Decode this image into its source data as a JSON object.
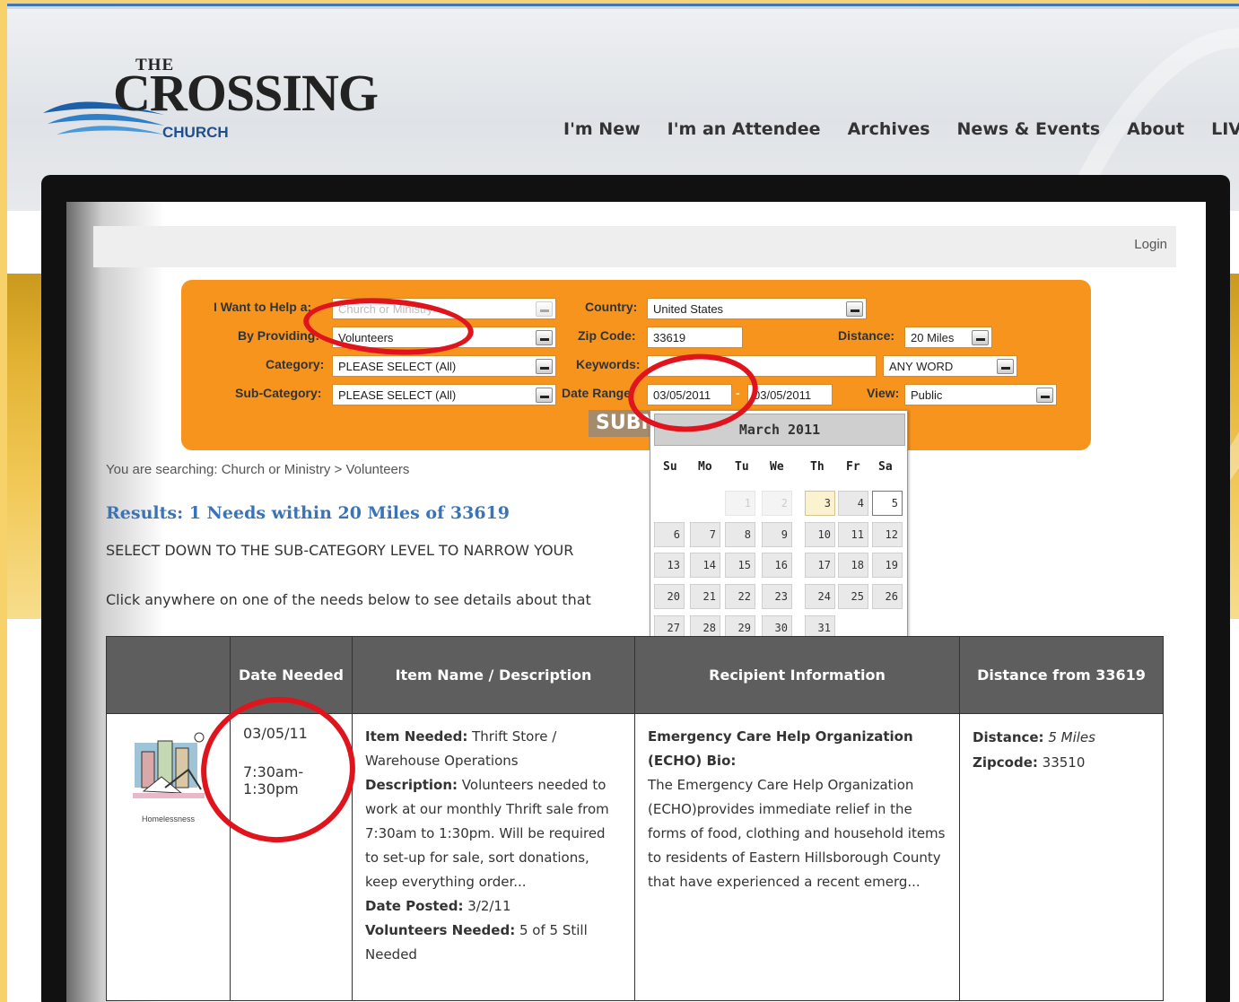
{
  "nav": [
    "I'm New",
    "I'm an Attendee",
    "Archives",
    "News & Events",
    "About",
    "LIVE"
  ],
  "logo": {
    "the": "THE",
    "crossing": "CROSSING",
    "church": "CHURCH"
  },
  "login": "Login",
  "search": {
    "help_label": "I Want to Help a:",
    "help_value": "Church or Ministry",
    "providing_label": "By Providing:",
    "providing_value": "Volunteers",
    "category_label": "Category:",
    "category_value": "PLEASE SELECT (All)",
    "subcategory_label": "Sub-Category:",
    "subcategory_value": "PLEASE SELECT (All)",
    "country_label": "Country:",
    "country_value": "United States",
    "zip_label": "Zip Code:",
    "zip_value": "33619",
    "distance_label": "Distance:",
    "distance_value": "20 Miles",
    "keywords_label": "Keywords:",
    "keywords_value": "",
    "keyword_mode": "ANY WORD",
    "daterange_label": "Date Range:",
    "date_from": "03/05/2011",
    "date_sep": "-",
    "date_to": "03/05/2011",
    "view_label": "View:",
    "view_value": "Public",
    "submit": "SUBMIT"
  },
  "calendar": {
    "title": "March 2011",
    "dow": [
      "Su",
      "Mo",
      "Tu",
      "We",
      "Th",
      "Fr",
      "Sa"
    ],
    "weeks": [
      [
        "",
        "",
        "1",
        "2",
        "3",
        "4",
        "5"
      ],
      [
        "6",
        "7",
        "8",
        "9",
        "10",
        "11",
        "12"
      ],
      [
        "13",
        "14",
        "15",
        "16",
        "17",
        "18",
        "19"
      ],
      [
        "20",
        "21",
        "22",
        "23",
        "24",
        "25",
        "26"
      ],
      [
        "27",
        "28",
        "29",
        "30",
        "31",
        "",
        ""
      ]
    ]
  },
  "breadcrumb": "You are searching: Church or Ministry > Volunteers",
  "results_title": "Results: 1 Needs within 20 Miles of 33619",
  "narrow_text": "SELECT DOWN TO THE SUB-CATEGORY LEVEL TO NARROW YOUR",
  "click_text": "Click anywhere on one of the needs below to see details about that",
  "table": {
    "headers": [
      "",
      "Date Needed",
      "Item Name / Description",
      "Recipient Information",
      "Distance from 33619"
    ],
    "row": {
      "category": "Homelessness",
      "date": "03/05/11",
      "time": "7:30am-1:30pm",
      "item_label": "Item Needed:",
      "item_value": "Thrift Store / Warehouse Operations",
      "desc_label": "Description:",
      "desc_value": "Volunteers needed to work at our monthly Thrift sale from 7:30am to 1:30pm. Will be required to set-up for sale, sort donations, keep everything order...",
      "posted_label": "Date Posted:",
      "posted_value": "3/2/11",
      "vol_label": "Volunteers Needed:",
      "vol_value": "5 of 5 Still Needed",
      "org": "Emergency Care Help Organization (ECHO) Bio:",
      "bio": "The Emergency Care Help Organization (ECHO)provides immediate relief in the forms of food, clothing and household items to residents of Eastern Hillsborough County that have experienced a recent emerg...",
      "distance_label": "Distance:",
      "distance_value": "5 Miles",
      "zip_label": "Zipcode:",
      "zip_value": "33510"
    }
  }
}
